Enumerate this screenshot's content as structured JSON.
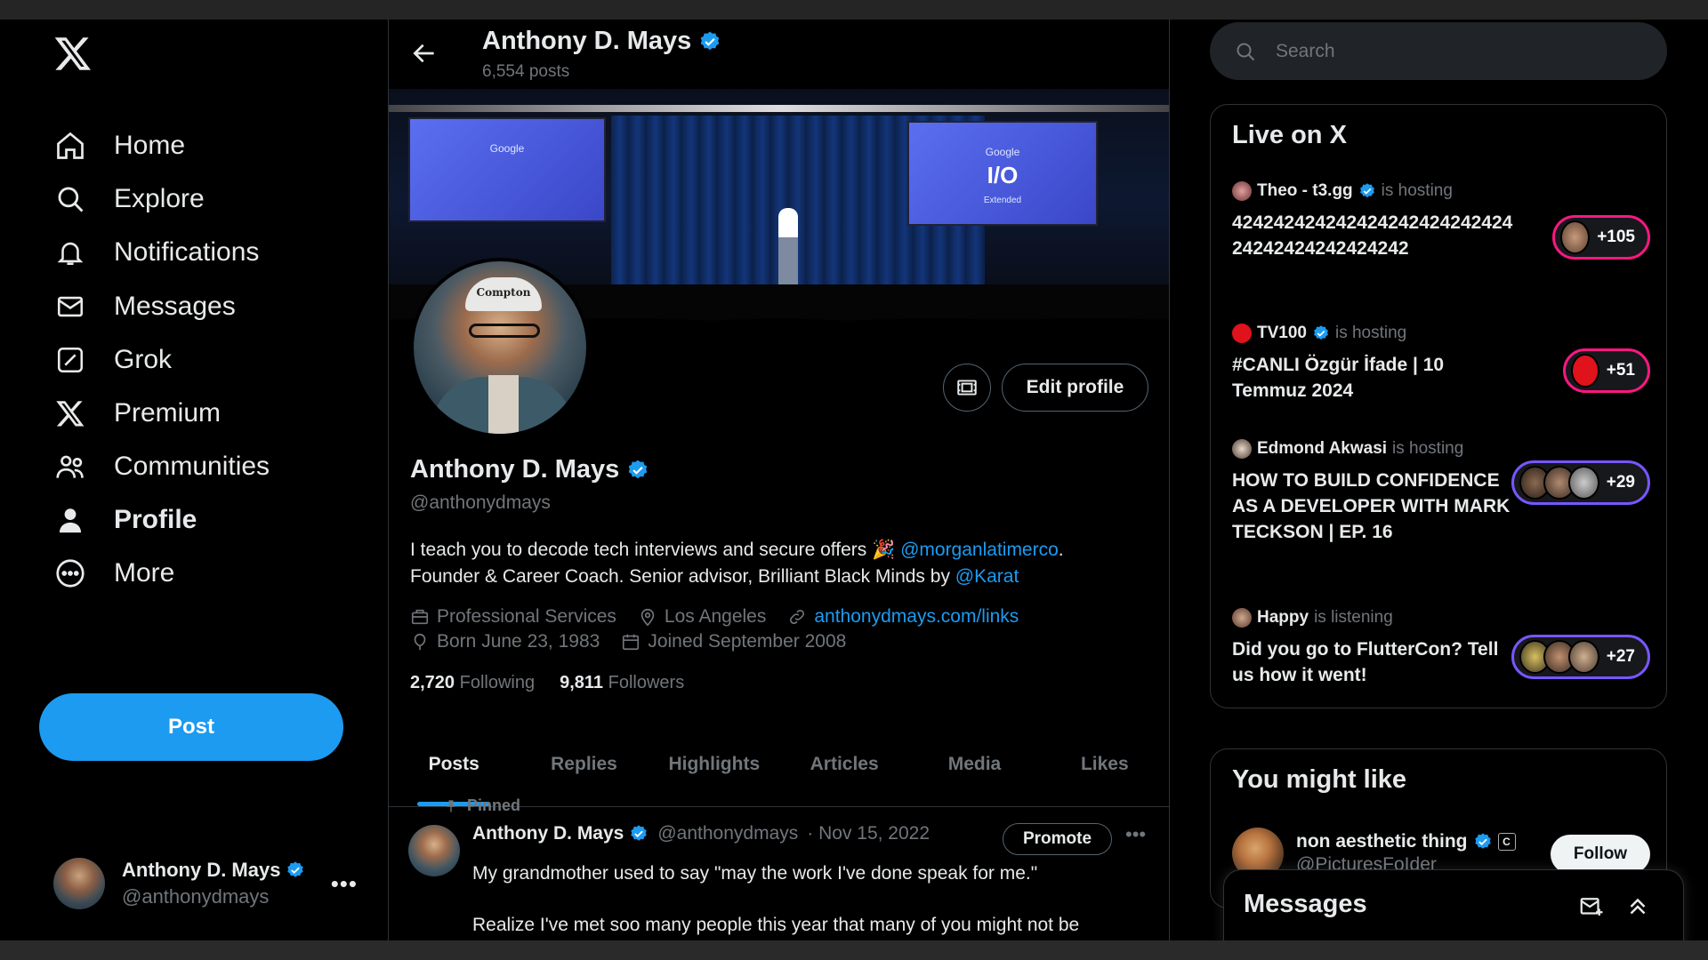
{
  "nav": {
    "items": [
      {
        "label": "Home",
        "icon": "home-icon"
      },
      {
        "label": "Explore",
        "icon": "search-icon"
      },
      {
        "label": "Notifications",
        "icon": "bell-icon"
      },
      {
        "label": "Messages",
        "icon": "mail-icon"
      },
      {
        "label": "Grok",
        "icon": "grok-icon"
      },
      {
        "label": "Premium",
        "icon": "x-logo-icon"
      },
      {
        "label": "Communities",
        "icon": "people-icon"
      },
      {
        "label": "Profile",
        "icon": "person-icon"
      },
      {
        "label": "More",
        "icon": "more-circle-icon"
      }
    ],
    "active": "Profile",
    "post_label": "Post"
  },
  "account": {
    "name": "Anthony D. Mays",
    "handle": "@anthonydmays"
  },
  "header": {
    "name": "Anthony D. Mays",
    "posts": "6,554 posts"
  },
  "banner": {
    "screen_text": "Google",
    "screen_text2": "I/O",
    "screen_sub": "Extended"
  },
  "profile": {
    "cap_text": "Compton",
    "name": "Anthony D. Mays",
    "handle": "@anthonydmays",
    "edit_label": "Edit profile",
    "bio_line1": "I teach you to decode tech interviews and secure offers 🎉 ",
    "bio_mention1": "@morganlatimerco",
    "bio_line1_end": ".",
    "bio_line2": "Founder & Career Coach. Senior advisor, Brilliant Black Minds by ",
    "bio_mention2": "@Karat",
    "category": "Professional Services",
    "location": "Los Angeles",
    "website": "anthonydmays.com/links",
    "born": "Born June 23, 1983",
    "joined": "Joined September 2008",
    "following_count": "2,720",
    "following_label": "Following",
    "followers_count": "9,811",
    "followers_label": "Followers"
  },
  "tabs": [
    "Posts",
    "Replies",
    "Highlights",
    "Articles",
    "Media",
    "Likes"
  ],
  "active_tab": "Posts",
  "tweet": {
    "pinned_label": "Pinned",
    "name": "Anthony D. Mays",
    "handle": "@anthonydmays",
    "date": "· Nov 15, 2022",
    "promote_label": "Promote",
    "line1": "My grandmother used to say \"may the work I've done speak for me.\"",
    "line2": "Realize I've met soo many people this year that many of you might not be"
  },
  "search": {
    "placeholder": "Search"
  },
  "live": {
    "title": "Live on X",
    "items": [
      {
        "host": "Theo - t3.gg",
        "verified": true,
        "status": "is hosting",
        "title": "42424242424242424242424242424242424242424242",
        "count": "+105",
        "border": "#f91880"
      },
      {
        "host": "TV100",
        "verified": true,
        "status": "is hosting",
        "title": "#CANLI Özgür İfade | 10 Temmuz 2024",
        "count": "+51",
        "border": "#f91880"
      },
      {
        "host": "Edmond Akwasi",
        "verified": false,
        "status": "is hosting",
        "title": "HOW TO BUILD CONFIDENCE AS A DEVELOPER WITH MARK TECKSON | EP. 16",
        "count": "+29",
        "border": "#7856ff"
      },
      {
        "host": "Happy",
        "verified": false,
        "status": "is listening",
        "title": "Did you go to FlutterCon? Tell us how it went!",
        "count": "+27",
        "border": "#7856ff"
      }
    ]
  },
  "might_like": {
    "title": "You might like",
    "name": "non aesthetic thing",
    "handle": "@PicturesFoIder",
    "badge": "C",
    "follow_label": "Follow"
  },
  "messages_drawer": {
    "title": "Messages"
  },
  "colors": {
    "accent": "#1d9bf0",
    "bg": "#000000",
    "muted": "#71767b",
    "border": "#2f3336"
  }
}
